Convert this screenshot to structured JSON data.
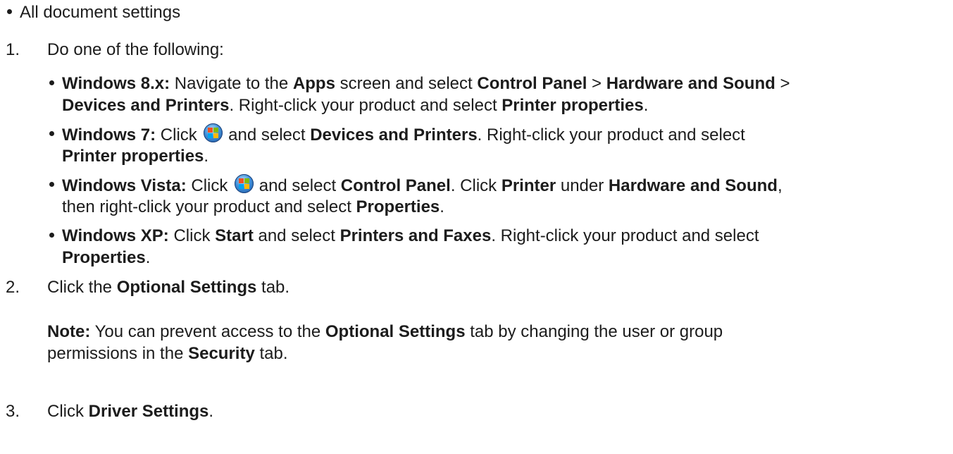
{
  "top_bullet": "All document settings",
  "steps": [
    {
      "number": "1.",
      "text": "Do one of the following:"
    },
    {
      "number": "2.",
      "text_prefix": "Click the ",
      "bold": "Optional Settings",
      "text_suffix": " tab."
    },
    {
      "number": "3.",
      "text_prefix": "Click ",
      "bold": "Driver Settings",
      "text_suffix": "."
    }
  ],
  "win8": {
    "label": "Windows 8.x:",
    "t1": " Navigate to the ",
    "apps": "Apps",
    "t2": " screen and select ",
    "control_panel": "Control Panel",
    "sep1": " > ",
    "hardware_sound": "Hardware and Sound",
    "sep2": " >",
    "devices_printers": "Devices and Printers",
    "t3": ". Right-click your product and select ",
    "printer_properties": "Printer properties",
    "end": "."
  },
  "win7": {
    "label": "Windows 7:",
    "t1": " Click ",
    "t2": " and select ",
    "devices_printers": "Devices and Printers",
    "t3": ". Right-click your product and select",
    "printer_properties": "Printer properties",
    "end": "."
  },
  "vista": {
    "label": "Windows Vista:",
    "t1": " Click ",
    "t2": " and select ",
    "control_panel": "Control Panel",
    "t3": ". Click ",
    "printer": "Printer",
    "t4": " under ",
    "hardware_sound": "Hardware and Sound",
    "t5": ",",
    "t6": "then right-click your product and select ",
    "properties": "Properties",
    "end": "."
  },
  "xp": {
    "label": "Windows XP:",
    "t1": " Click ",
    "start": "Start",
    "t2": " and select ",
    "printers_faxes": "Printers and Faxes",
    "t3": ". Right-click your product and select",
    "properties": "Properties",
    "end": "."
  },
  "note": {
    "label": "Note:",
    "t1": " You can prevent access to the ",
    "optional_settings": "Optional Settings",
    "t2": " tab by changing the user or group",
    "t3": "permissions in the ",
    "security": "Security",
    "t4": " tab."
  },
  "icons": {
    "windows_start": "windows-start-orb-icon"
  }
}
